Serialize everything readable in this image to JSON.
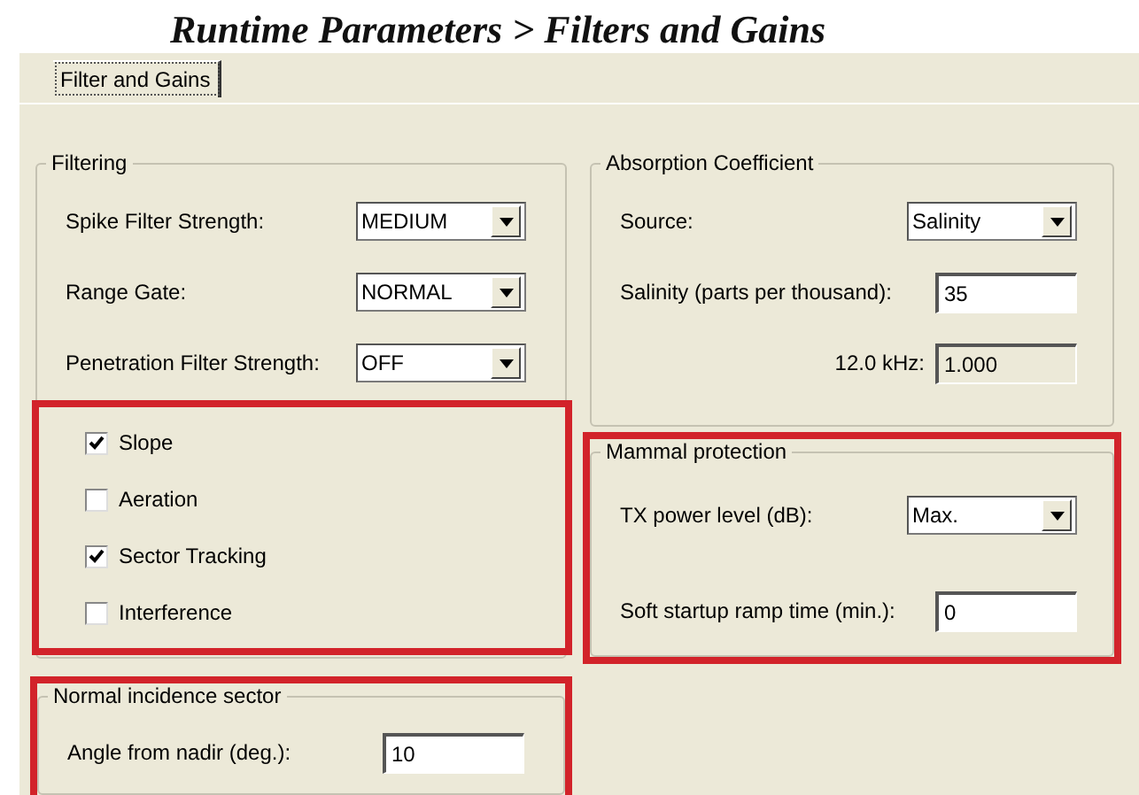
{
  "heading": "Runtime Parameters > Filters and Gains",
  "tabs": [
    {
      "label": "Filter and Gains",
      "selected": true
    }
  ],
  "left_groups": [
    {
      "title": "Filtering",
      "highlighted": false,
      "fields": [
        {
          "kind": "dropdown",
          "label": "Spike Filter Strength:",
          "value": "MEDIUM",
          "disabled": false
        },
        {
          "kind": "dropdown",
          "label": "Range Gate:",
          "value": "NORMAL",
          "disabled": false
        },
        {
          "kind": "dropdown",
          "label": "Penetration Filter Strength:",
          "value": "OFF",
          "disabled": false
        }
      ],
      "checkboxes_highlighted": true,
      "checkboxes": [
        {
          "label": "Slope",
          "checked": true
        },
        {
          "label": "Aeration",
          "checked": false
        },
        {
          "label": "Sector Tracking",
          "checked": true
        },
        {
          "label": "Interference",
          "checked": false
        }
      ]
    },
    {
      "title": "Normal incidence sector",
      "highlighted": true,
      "fields": [
        {
          "kind": "text",
          "label": "Angle from nadir (deg.):",
          "value": "10",
          "disabled": false
        }
      ]
    }
  ],
  "right_groups": [
    {
      "title": "Absorption Coefficient",
      "highlighted": false,
      "fields": [
        {
          "kind": "dropdown",
          "label": "Source:",
          "value": "Salinity",
          "disabled": false
        },
        {
          "kind": "text",
          "label": "Salinity (parts per thousand):",
          "value": "35",
          "disabled": false
        },
        {
          "kind": "text",
          "label": "12.0 kHz:",
          "value": "1.000",
          "disabled": true
        }
      ]
    },
    {
      "title": "Mammal protection",
      "highlighted": true,
      "fields": [
        {
          "kind": "dropdown",
          "label": "TX power level (dB):",
          "value": "Max.",
          "disabled": false
        },
        {
          "kind": "text",
          "label": "Soft startup ramp time (min.):",
          "value": "0",
          "disabled": false
        }
      ]
    }
  ]
}
